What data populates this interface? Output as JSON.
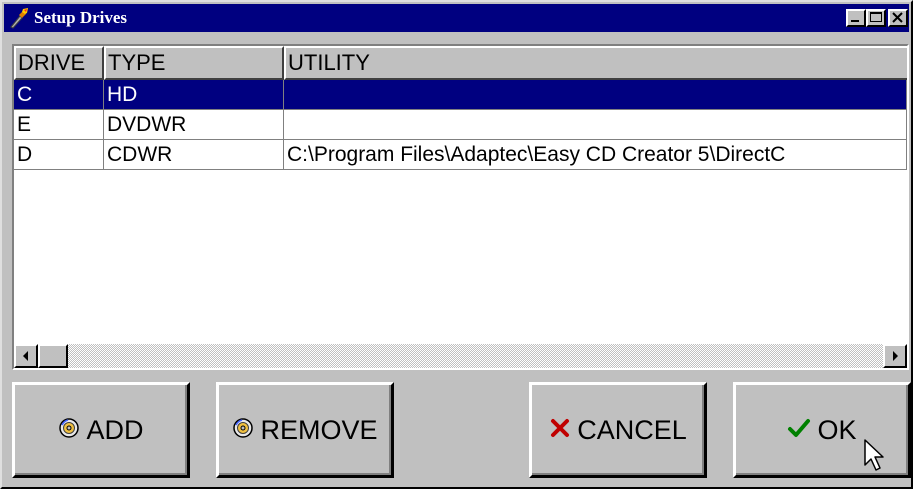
{
  "window": {
    "title": "Setup Drives"
  },
  "table": {
    "columns": [
      "DRIVE",
      "TYPE",
      "UTILITY"
    ],
    "rows": [
      {
        "drive": "C",
        "type": "HD",
        "utility": "",
        "selected": true
      },
      {
        "drive": "E",
        "type": "DVDWR",
        "utility": ""
      },
      {
        "drive": "D",
        "type": "CDWR",
        "utility": "C:\\Program Files\\Adaptec\\Easy CD Creator 5\\DirectC"
      }
    ]
  },
  "buttons": {
    "add": "ADD",
    "remove": "REMOVE",
    "cancel": "CANCEL",
    "ok": "OK"
  },
  "colors": {
    "title_bar": "#000080",
    "selection": "#000080",
    "face": "#c0c0c0",
    "cancel_icon": "#c00000",
    "ok_icon": "#008000"
  }
}
